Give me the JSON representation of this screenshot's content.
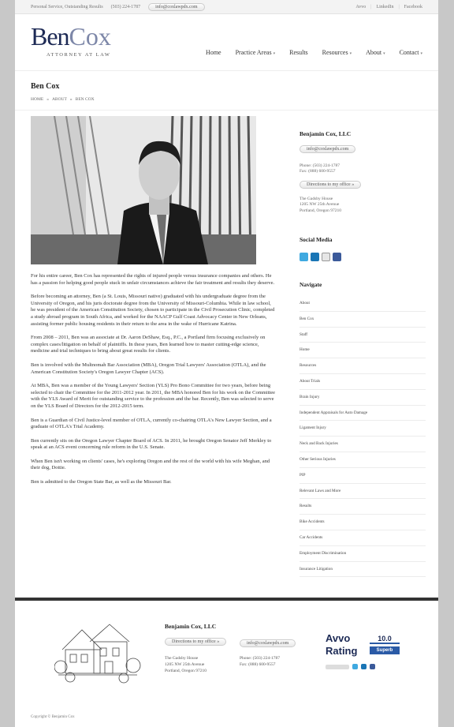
{
  "topbar": {
    "tagline": "Personal Service, Outstanding Results",
    "phone": "(503) 224-1787",
    "email": "info@coxlawpdx.com",
    "links": [
      "Avvo",
      "LinkedIn",
      "Facebook"
    ]
  },
  "logo": {
    "first": "Ben",
    "last": "Cox",
    "subtitle": "ATTORNEY AT LAW"
  },
  "nav": [
    "Home",
    "Practice Areas",
    "Results",
    "Resources",
    "About",
    "Contact"
  ],
  "page": {
    "title": "Ben Cox",
    "breadcrumb": [
      "HOME",
      "ABOUT",
      "BEN COX"
    ]
  },
  "bio": [
    "For his entire career, Ben Cox has represented the rights of injured people versus insurance companies and others. He has a passion for helping good people stuck in unfair circumstances achieve the fair treatment and results they deserve.",
    "Before becoming an attorney, Ben (a St. Louis, Missouri native) graduated with his undergraduate degree from the University of Oregon, and his juris doctorate degree from the University of Missouri-Columbia. While in law school, he was president of the American Constitution Society, chosen to participate in the Civil Prosecution Clinic, completed a study abroad program in South Africa, and worked for the NAACP Gulf Coast Advocacy Center in New Orleans, assisting former public housing residents in their return to the area in the wake of Hurricane Katrina.",
    "From 2008 – 2011, Ben was an associate at Dr. Aaron DeShaw, Esq., P.C., a Portland firm focusing exclusively on complex cases/litigation on behalf of plaintiffs. In these years, Ben learned how to master cutting-edge science, medicine and trial techniques to bring about great results for clients.",
    "Ben is involved with the Multnomah Bar Association (MBA), Oregon Trial Lawyers' Association (OTLA), and the American Constitution Society's Oregon Lawyer Chapter (ACS).",
    "At MBA, Ben was a member of the Young Lawyers' Section (YLS) Pro Bono Committee for two years, before being selected to chair the Committee for the 2011-2012 year. In 2011, the MBA honored Ben for his work on the Committee with the YLS Award of Merit for outstanding service to the profession and the bar. Recently, Ben was selected to serve on the YLS Board of Directors for the 2012-2015 term.",
    "Ben is a Guardian of Civil Justice-level member of OTLA, currently co-chairing OTLA's New Lawyer Section, and a graduate of OTLA's Trial Academy.",
    "Ben currently sits on the Oregon Lawyer Chapter Board of ACS. In 2011, he brought Oregon Senator Jeff Merkley to speak at an ACS event concerning rule reform in the U.S. Senate.",
    "When Ben isn't working on clients' cases, he's exploring Oregon and the rest of the world with his wife Meghan, and their dog, Dottie.",
    "Ben is admitted to the Oregon State Bar, as well as the Missouri Bar."
  ],
  "sidebar": {
    "firm": "Benjamin Cox, LLC",
    "email": "info@coxlawpdx.com",
    "phone": "Phone: (503) 224-1787",
    "fax": "Fax: (888) 600-9557",
    "directions": "Directions to my office »",
    "address": [
      "The Gadsby House",
      "1205 NW 25th Avenue",
      "Portland, Oregon 97210"
    ],
    "social_title": "Social Media",
    "navigate_title": "Navigate",
    "navigate": [
      "About",
      "Ben Cox",
      "Staff",
      "Home",
      "Resources",
      "About Trials",
      "Brain Injury",
      "Independent Appraisals for Auto Damage",
      "Ligament Injury",
      "Neck and Back Injuries",
      "Other Serious Injuries",
      "PIP",
      "Relevant Laws and More",
      "Results",
      "Bike Accidents",
      "Car Accidents",
      "Employment Discrimination",
      "Insurance Litigation"
    ]
  },
  "footer": {
    "firm": "Benjamin Cox, LLC",
    "directions": "Directions to my office »",
    "email": "info@coxlawpdx.com",
    "address": [
      "The Gadsby House",
      "1205 NW 25th Avenue",
      "Portland, Oregon 97210"
    ],
    "phone": "Phone: (503) 224-1787",
    "fax": "Fax: (888) 600-9557",
    "avvo_word": "Avvo",
    "avvo_rating": "Rating",
    "avvo_score": "10.0",
    "avvo_label": "Superb",
    "copyright": "Copyright © Benjamin Cox"
  }
}
